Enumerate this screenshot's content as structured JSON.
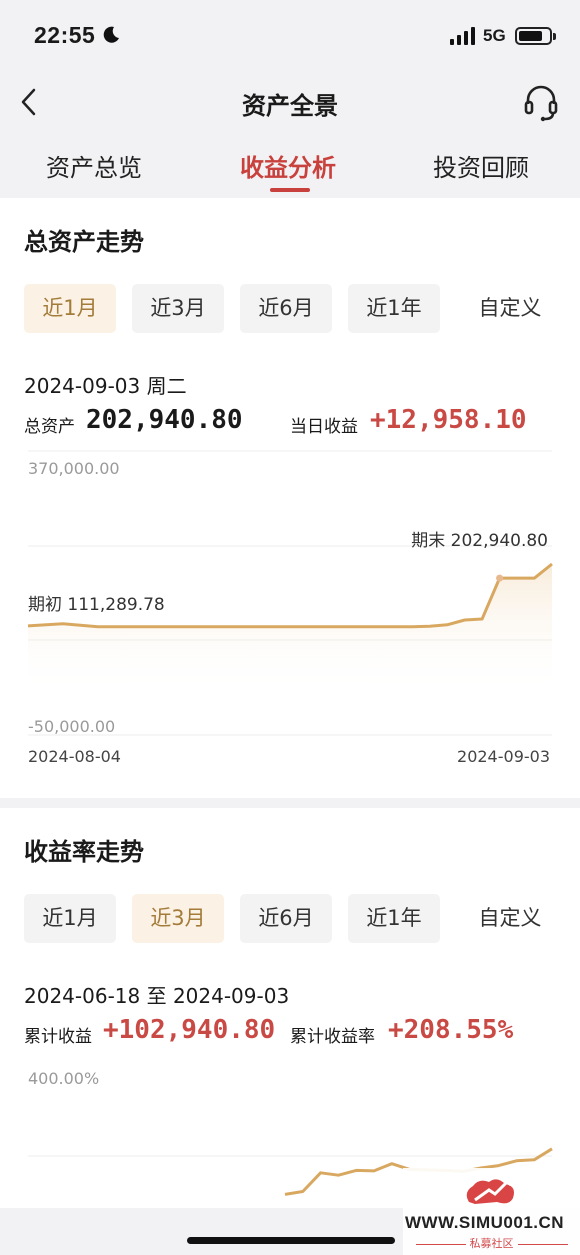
{
  "status_bar": {
    "time": "22:55",
    "network": "5G"
  },
  "nav": {
    "title": "资产全景"
  },
  "tabs": [
    {
      "label": "资产总览",
      "active": false
    },
    {
      "label": "收益分析",
      "active": true
    },
    {
      "label": "投资回顾",
      "active": false
    }
  ],
  "asset_trend": {
    "title": "总资产走势",
    "periods": [
      "近1月",
      "近3月",
      "近6月",
      "近1年",
      "自定义"
    ],
    "active_period": "近1月",
    "date": "2024-09-03 周二",
    "total_asset_label": "总资产",
    "total_asset_value": "202,940.80",
    "daily_income_label": "当日收益",
    "daily_income_value": "+12,958.10"
  },
  "return_trend": {
    "title": "收益率走势",
    "periods": [
      "近1月",
      "近3月",
      "近6月",
      "近1年",
      "自定义"
    ],
    "active_period": "近3月",
    "date_range": "2024-06-18 至 2024-09-03",
    "cum_income_label": "累计收益",
    "cum_income_value": "+102,940.80",
    "cum_rate_label": "累计收益率",
    "cum_rate_value": "+208.55%"
  },
  "chart_data": [
    {
      "type": "area",
      "title": "",
      "ylim": [
        -50000,
        370000
      ],
      "y_tick_labels": [
        "370,000.00",
        "-50,000.00"
      ],
      "x_tick_labels": [
        "2024-08-04",
        "2024-09-03"
      ],
      "start_annotation": "期初 111,289.78",
      "end_annotation": "期末 202,940.80",
      "series": [
        {
          "x": [
            "2024-08-04",
            "2024-08-06",
            "2024-08-08",
            "2024-08-10",
            "2024-08-12",
            "2024-08-14",
            "2024-08-16",
            "2024-08-18",
            "2024-08-20",
            "2024-08-22",
            "2024-08-24",
            "2024-08-26",
            "2024-08-27",
            "2024-08-28",
            "2024-08-29",
            "2024-08-30",
            "2024-08-31",
            "2024-09-01",
            "2024-09-02",
            "2024-09-03"
          ],
          "values": [
            111289.78,
            114500,
            110000,
            110000,
            110000,
            110000,
            110000,
            110000,
            110000,
            110000,
            110000,
            110000,
            110800,
            113000,
            120000,
            121500,
            182000,
            182000,
            182000,
            202940.8
          ]
        }
      ],
      "color": "#d9a860"
    },
    {
      "type": "line",
      "title": "",
      "y_tick_labels": [
        "400.00%"
      ],
      "ylim": [
        0,
        400
      ],
      "series": [
        {
          "x": [
            0,
            1,
            2,
            3,
            4,
            5,
            6,
            7,
            8,
            9,
            10,
            11,
            12,
            13,
            14,
            15
          ],
          "values": [
            120,
            126,
            165,
            160,
            170,
            169,
            184,
            172,
            171,
            170,
            168,
            175,
            180,
            190,
            192,
            215
          ]
        }
      ],
      "color": "#d9a860"
    }
  ],
  "watermark": {
    "site": "WWW.SIMU001.CN",
    "sub": "私募社区"
  }
}
